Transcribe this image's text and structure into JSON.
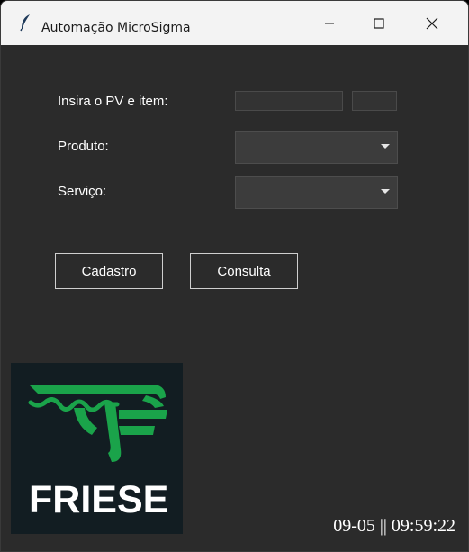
{
  "window": {
    "title": "Automação MicroSigma",
    "icons": [
      "feather-icon",
      "minimize-icon",
      "maximize-icon",
      "close-icon"
    ]
  },
  "form": {
    "pv_label": "Insira o PV e item:",
    "pv_value": "",
    "item_value": "",
    "produto_label": "Produto:",
    "produto_value": "",
    "servico_label": "Serviço:",
    "servico_value": ""
  },
  "buttons": {
    "cadastro": "Cadastro",
    "consulta": "Consulta"
  },
  "logo": {
    "text": "FRIESE",
    "brand_color": "#1aa34a"
  },
  "clock": "09-05 || 09:59:22",
  "colors": {
    "background": "#2b2b2b",
    "titlebar": "#f3f3f3"
  }
}
